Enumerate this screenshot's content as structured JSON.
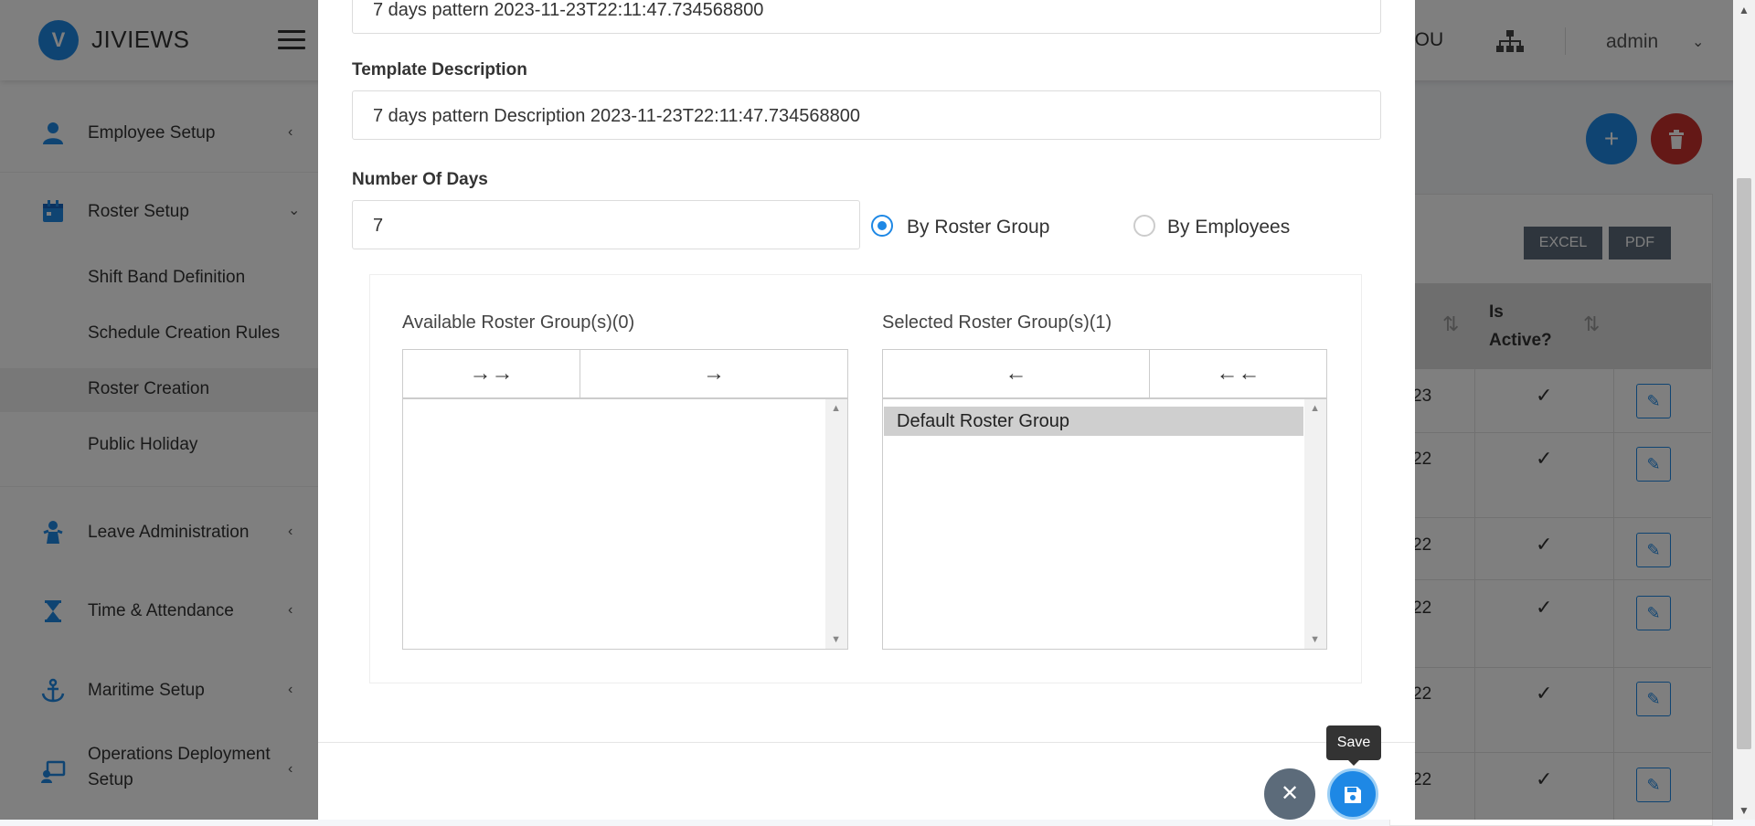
{
  "app": {
    "brand_initial": "V",
    "brand_name": "JIVIEWS",
    "ou_label": "TO OU",
    "user_name": "admin"
  },
  "sidebar": {
    "items": [
      {
        "label": "Employee Setup",
        "icon": "employee-icon"
      },
      {
        "label": "Roster Setup",
        "icon": "calendar-icon"
      },
      {
        "label": "Leave Administration",
        "icon": "leave-icon"
      },
      {
        "label": "Time & Attendance",
        "icon": "hourglass-icon"
      },
      {
        "label": "Maritime Setup",
        "icon": "anchor-icon"
      },
      {
        "label": "Operations Deployment Setup",
        "icon": "deployment-icon"
      }
    ],
    "roster_sub": [
      "Shift Band Definition",
      "Schedule Creation Rules",
      "Roster Creation",
      "Public Holiday"
    ]
  },
  "background_table": {
    "export": [
      "EXCEL",
      "PDF"
    ],
    "header_is_active": "Is Active?",
    "rows": [
      "23",
      "22",
      "22",
      "22",
      "22",
      "22"
    ]
  },
  "modal": {
    "template_name_value": "7 days pattern 2023-11-23T22:11:47.734568800",
    "template_description_label": "Template Description",
    "template_description_value": "7 days pattern  Description  2023-11-23T22:11:47.734568800",
    "number_of_days_label": "Number Of Days",
    "number_of_days_value": "7",
    "radio_by_roster_group": "By Roster Group",
    "radio_by_employees": "By Employees",
    "selected_mode": "By Roster Group",
    "available_title": "Available Roster Group(s)(0)",
    "selected_title": "Selected Roster Group(s)(1)",
    "move_all_right": "→→",
    "move_right": "→",
    "move_left": "←",
    "move_all_left": "←←",
    "selected_options": [
      "Default Roster Group"
    ],
    "tooltip": "Save"
  },
  "colors": {
    "primary": "#1e88e5",
    "danger": "#c9302c",
    "cancel": "#5c6b7a"
  }
}
